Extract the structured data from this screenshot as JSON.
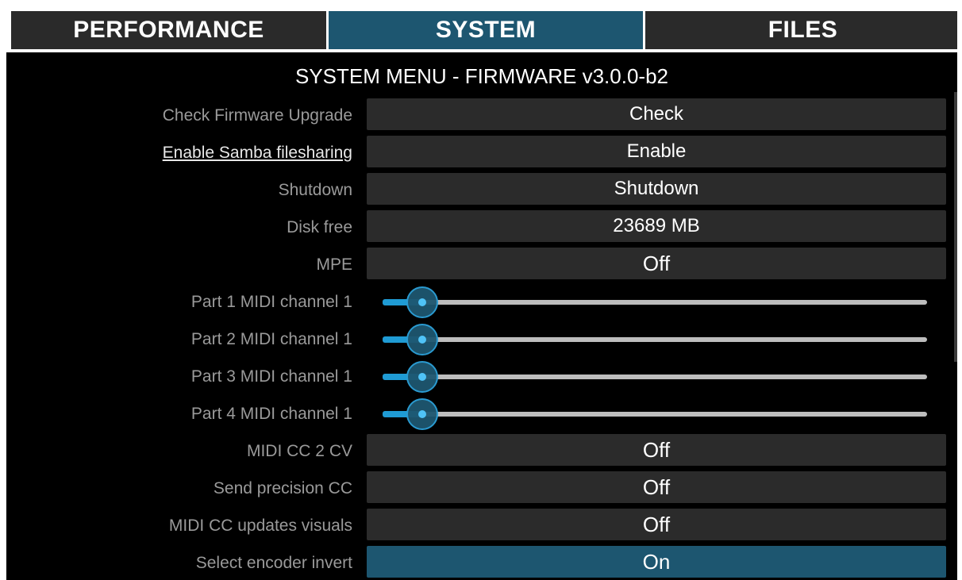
{
  "tabs": [
    {
      "label": "PERFORMANCE",
      "active": false
    },
    {
      "label": "SYSTEM",
      "active": true
    },
    {
      "label": "FILES",
      "active": false
    }
  ],
  "menu_title": "SYSTEM MENU - FIRMWARE v3.0.0-b2",
  "rows": {
    "check_firmware": {
      "label": "Check Firmware Upgrade",
      "value": "Check"
    },
    "samba": {
      "label": "Enable Samba filesharing",
      "value": "Enable"
    },
    "shutdown": {
      "label": "Shutdown",
      "value": "Shutdown"
    },
    "disk_free": {
      "label": "Disk free",
      "value": "23689 MB"
    },
    "mpe": {
      "label": "MPE",
      "value": "Off"
    },
    "part1": {
      "label": "Part 1 MIDI channel 1",
      "level": 0.05
    },
    "part2": {
      "label": "Part 2 MIDI channel 1",
      "level": 0.05
    },
    "part3": {
      "label": "Part 3 MIDI channel 1",
      "level": 0.05
    },
    "part4": {
      "label": "Part 4 MIDI channel 1",
      "level": 0.05
    },
    "cc2cv": {
      "label": "MIDI CC 2 CV",
      "value": "Off"
    },
    "precision_cc": {
      "label": "Send precision CC",
      "value": "Off"
    },
    "cc_visuals": {
      "label": "MIDI CC updates visuals",
      "value": "Off"
    },
    "encoder_invert": {
      "label": "Select encoder invert",
      "value": "On"
    }
  },
  "colors": {
    "accent": "#1d5670",
    "slider_accent": "#1f9bd4",
    "button_bg": "#2b2b2b",
    "label_text": "#9a9a9a"
  }
}
